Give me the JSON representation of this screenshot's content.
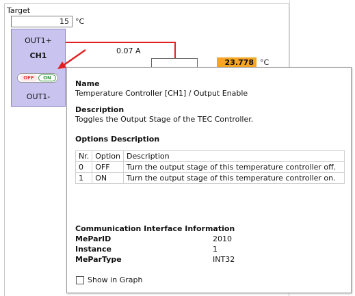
{
  "target": {
    "label": "Target",
    "value": "15",
    "unit": "°C"
  },
  "channel": {
    "out_plus": "OUT1+",
    "name": "CH1",
    "toggle_off": "OFF",
    "toggle_on": "ON",
    "out_minus": "OUT1-",
    "current": "0.07 A"
  },
  "temperature": {
    "value": "23.778",
    "unit": "°C"
  },
  "tooltip": {
    "name_header": "Name",
    "name_value": "Temperature Controller [CH1] / Output Enable",
    "desc_header": "Description",
    "desc_value": "Toggles the Output Stage of the TEC Controller.",
    "options_header": "Options Description",
    "columns": [
      "Nr.",
      "Option",
      "Description"
    ],
    "rows": [
      {
        "nr": "0",
        "option": "OFF",
        "description": "Turn the output stage of this temperature controller off."
      },
      {
        "nr": "1",
        "option": "ON",
        "description": "Turn the output stage of this temperature controller on."
      }
    ],
    "comm_header": "Communication Interface Information",
    "meparid_label": "MeParID",
    "meparid_value": "2010",
    "instance_label": "Instance",
    "instance_value": "1",
    "mepartype_label": "MeParType",
    "mepartype_value": "INT32",
    "show_in_graph": "Show in Graph"
  },
  "colors": {
    "channel_block": "#c9c3ef",
    "wire": "#e02020",
    "temp_badge": "#f7a623",
    "toggle_on": "#2e9a3a",
    "toggle_off": "#e0403a"
  }
}
